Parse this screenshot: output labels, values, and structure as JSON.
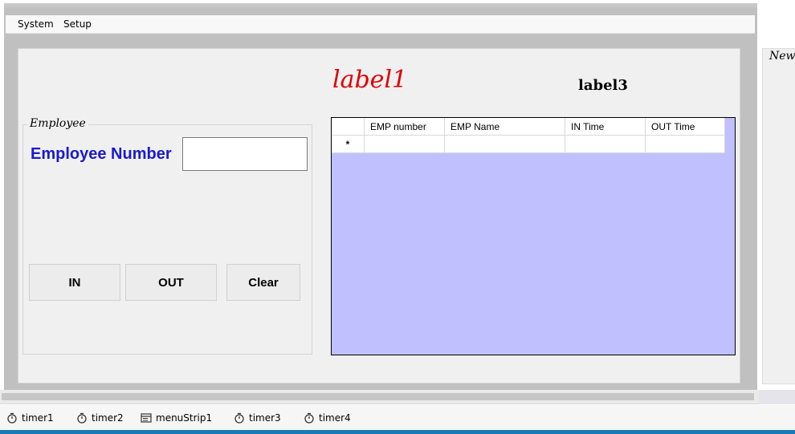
{
  "menu": {
    "items": [
      {
        "label": "System"
      },
      {
        "label": "Setup"
      }
    ]
  },
  "form": {
    "label1": "label1",
    "label3": "label3",
    "group_title": "Employee",
    "employee_number_label": "Employee Number",
    "employee_number_value": "",
    "buttons": {
      "in": "IN",
      "out": "OUT",
      "clear": "Clear"
    },
    "side_group_title": "New"
  },
  "grid": {
    "columns": [
      "EMP number",
      "EMP Name",
      "IN Time",
      "OUT Time"
    ],
    "new_row_marker": "*",
    "rows": []
  },
  "component_tray": {
    "items": [
      {
        "label": "timer1",
        "icon": "timer-icon"
      },
      {
        "label": "timer2",
        "icon": "timer-icon"
      },
      {
        "label": "menuStrip1",
        "icon": "menu-strip-icon"
      },
      {
        "label": "timer3",
        "icon": "timer-icon"
      },
      {
        "label": "timer4",
        "icon": "timer-icon"
      }
    ]
  },
  "colors": {
    "label1": "#e00000",
    "employee_label": "#1a1acc",
    "grid_background": "#c0c0ff",
    "bottom_bar": "#1a7ab5"
  }
}
